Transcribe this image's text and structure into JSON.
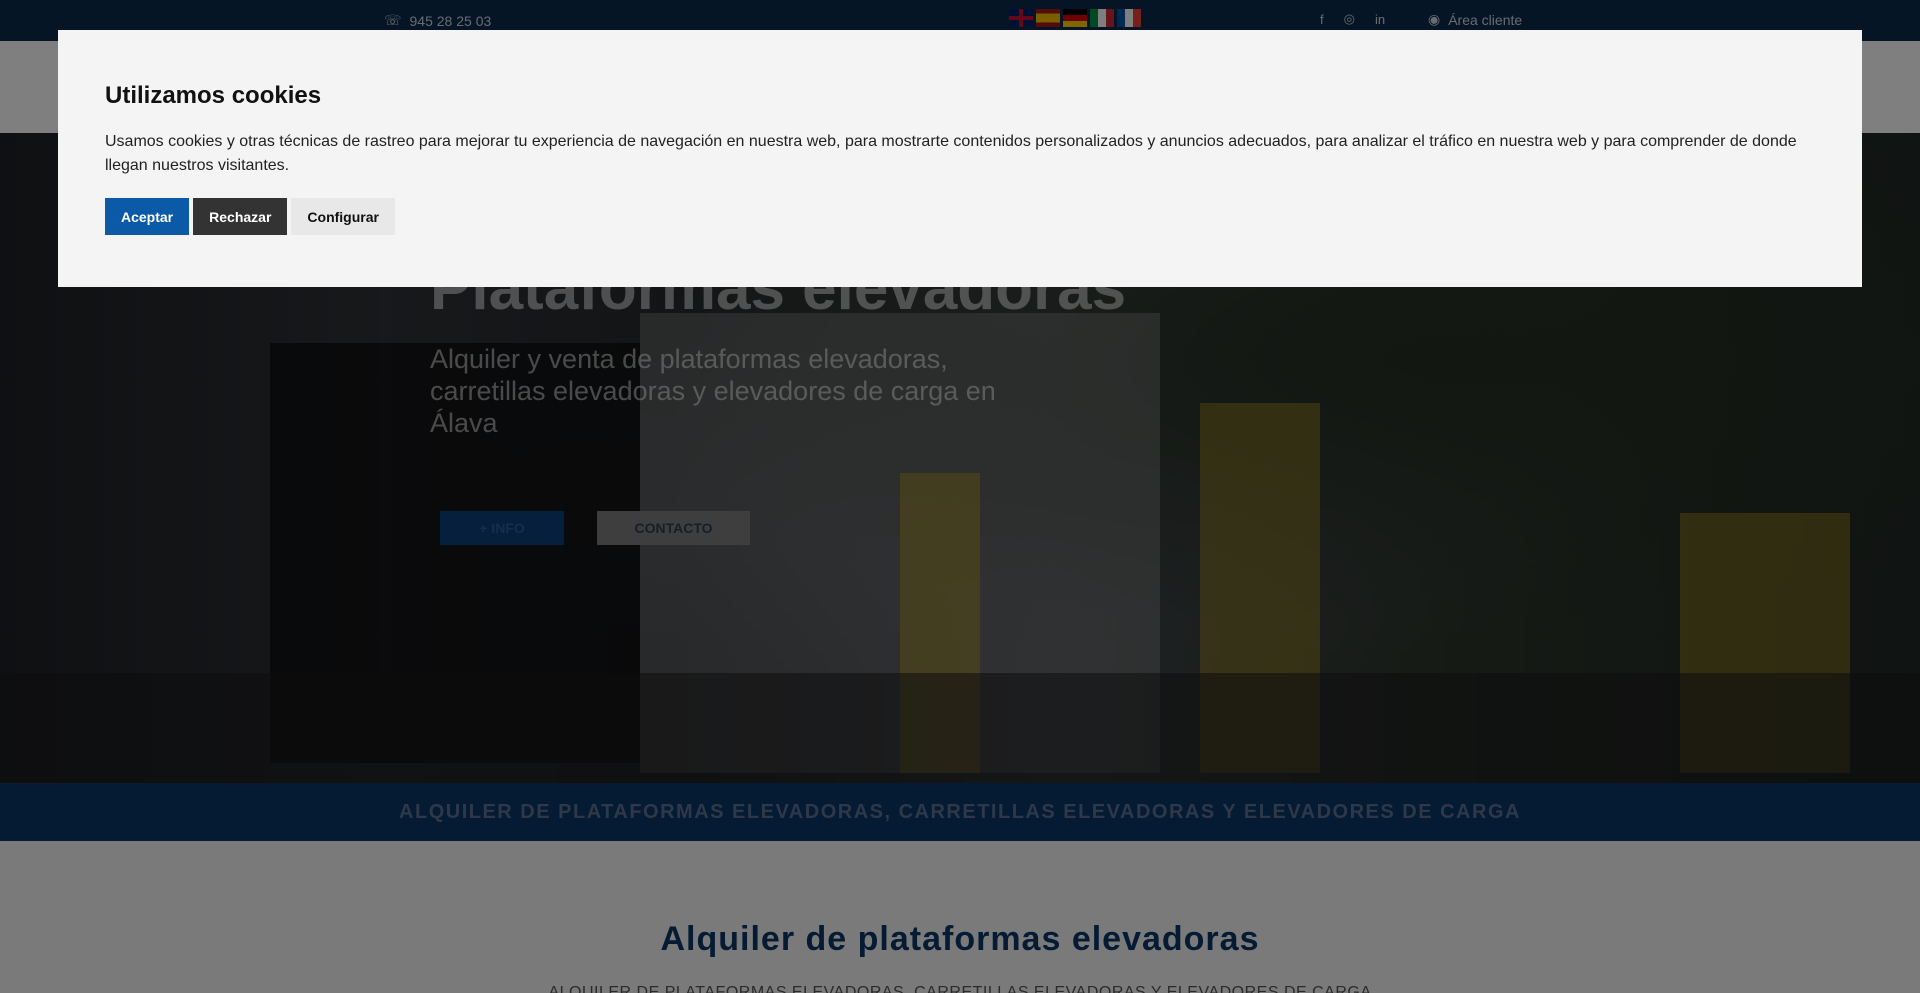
{
  "topbar": {
    "phone": "945 28 25 03",
    "phone_icon": "☏",
    "flags": [
      "uk-flag",
      "es-flag",
      "de-flag",
      "it-flag",
      "fr-flag"
    ],
    "social": {
      "facebook": "f",
      "instagram": "◎",
      "linkedin": "in"
    },
    "client_icon": "◉",
    "client_area": "Área cliente"
  },
  "hero": {
    "title": "Plataformas elevadoras",
    "subtitle": "Alquiler y venta de plataformas elevadoras, carretillas elevadoras y elevadores de carga en Álava",
    "info_button": "+ INFO",
    "contact_button": "CONTACTO"
  },
  "strip": {
    "text": "ALQUILER DE PLATAFORMAS ELEVADORAS, CARRETILLAS ELEVADORAS Y ELEVADORES DE CARGA"
  },
  "section": {
    "title": "Alquiler de plataformas elevadoras",
    "subtitle": "ALQUILER DE PLATAFORMAS ELEVADORAS, CARRETILLAS ELEVADORAS Y ELEVADORES DE CARGA"
  },
  "cookie": {
    "title": "Utilizamos cookies",
    "text": "Usamos cookies y otras técnicas de rastreo para mejorar tu experiencia de navegación en nuestra web, para mostrarte contenidos personalizados y anuncios adecuados, para analizar el tráfico en nuestra web y para comprender de donde llegan nuestros visitantes.",
    "accept": "Aceptar",
    "reject": "Rechazar",
    "configure": "Configurar"
  },
  "colors": {
    "navy": "#0a2a4a",
    "brand_blue": "#0a3766",
    "accept_blue": "#0a5aa8",
    "reject_dark": "#333333"
  }
}
